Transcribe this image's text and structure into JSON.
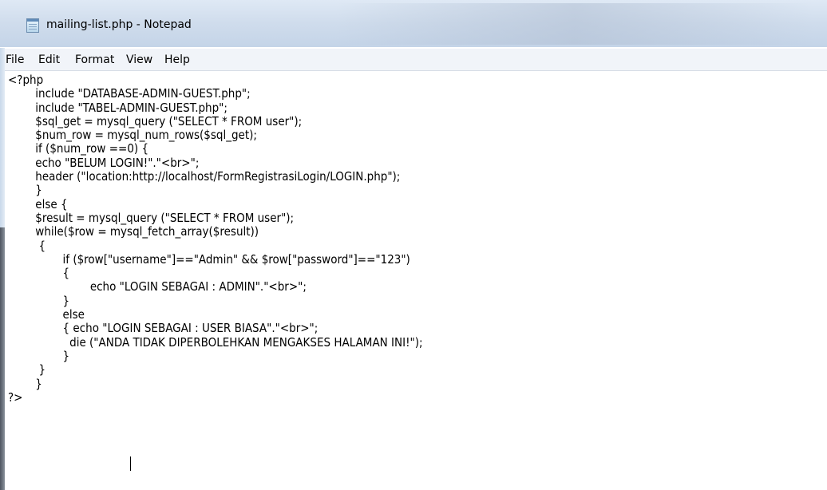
{
  "window": {
    "title": "mailing-list.php - Notepad",
    "app_icon": "notepad-icon"
  },
  "menubar": {
    "items": [
      "File",
      "Edit",
      "Format",
      "View",
      "Help"
    ]
  },
  "editor": {
    "lines": [
      "<?php",
      "        include \"DATABASE-ADMIN-GUEST.php\";",
      "        include \"TABEL-ADMIN-GUEST.php\";",
      "        $sql_get = mysql_query (\"SELECT * FROM user\");",
      "        $num_row = mysql_num_rows($sql_get);",
      "        if ($num_row ==0) {",
      "        echo \"BELUM LOGIN!\".\"<br>\";",
      "        header (\"location:http://localhost/FormRegistrasiLogin/LOGIN.php\");",
      "        }",
      "        else {",
      "        $result = mysql_query (\"SELECT * FROM user\");",
      "        while($row = mysql_fetch_array($result))",
      "         {",
      "                if ($row[\"username\"]==\"Admin\" && $row[\"password\"]==\"123\")",
      "                {",
      "                        echo \"LOGIN SEBAGAI : ADMIN\".\"<br>\";",
      "                }",
      "                else",
      "                { echo \"LOGIN SEBAGAI : USER BIASA\".\"<br>\";",
      "                  die (\"ANDA TIDAK DIPERBOLEHKAN MENGAKSES HALAMAN INI!\");",
      "                }",
      "         }",
      "        }",
      "?>"
    ]
  }
}
